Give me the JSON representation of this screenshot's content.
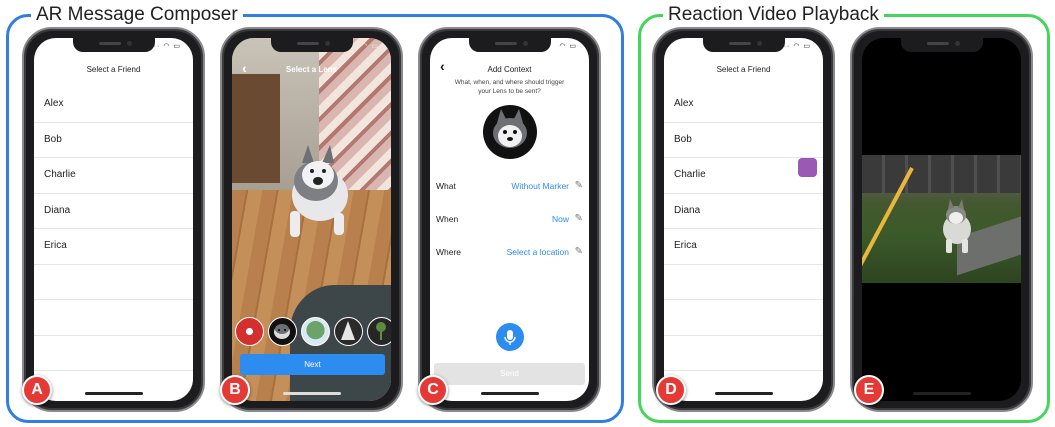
{
  "groups": {
    "ar_title": "AR Message Composer",
    "rx_title": "Reaction Video Playback",
    "ar_color": "#2f7ee0",
    "rx_color": "#43d65a"
  },
  "screens": {
    "a": {
      "badge": "A",
      "title": "Select a Friend",
      "friends": [
        "Alex",
        "Bob",
        "Charlie",
        "Diana",
        "Erica"
      ]
    },
    "b": {
      "badge": "B",
      "title": "Select a Lens",
      "back_icon": "chevron-left-icon",
      "next_label": "Next",
      "lenses": [
        "spider-mask-lens",
        "husky-lens",
        "tree-lens",
        "pine-tree-lens",
        "palm-tree-lens"
      ]
    },
    "c": {
      "badge": "C",
      "title": "Add Context",
      "back_icon": "chevron-left-icon",
      "subtitle": "What, when, and where should trigger your Lens to be sent?",
      "rows": [
        {
          "label": "What",
          "value": "Without Marker"
        },
        {
          "label": "When",
          "value": "Now"
        },
        {
          "label": "Where",
          "value": "Select a location"
        }
      ],
      "mic_icon": "microphone-icon",
      "send_label": "Send"
    },
    "d": {
      "badge": "D",
      "title": "Select a Friend",
      "friends": [
        "Alex",
        "Bob",
        "Charlie",
        "Diana",
        "Erica"
      ],
      "indicator_color": "#9b59b6"
    },
    "e": {
      "badge": "E",
      "video": "reaction-video-husky-on-lawn"
    }
  },
  "colors": {
    "accent_blue": "#2d8cf0",
    "badge_red": "#e53935"
  }
}
